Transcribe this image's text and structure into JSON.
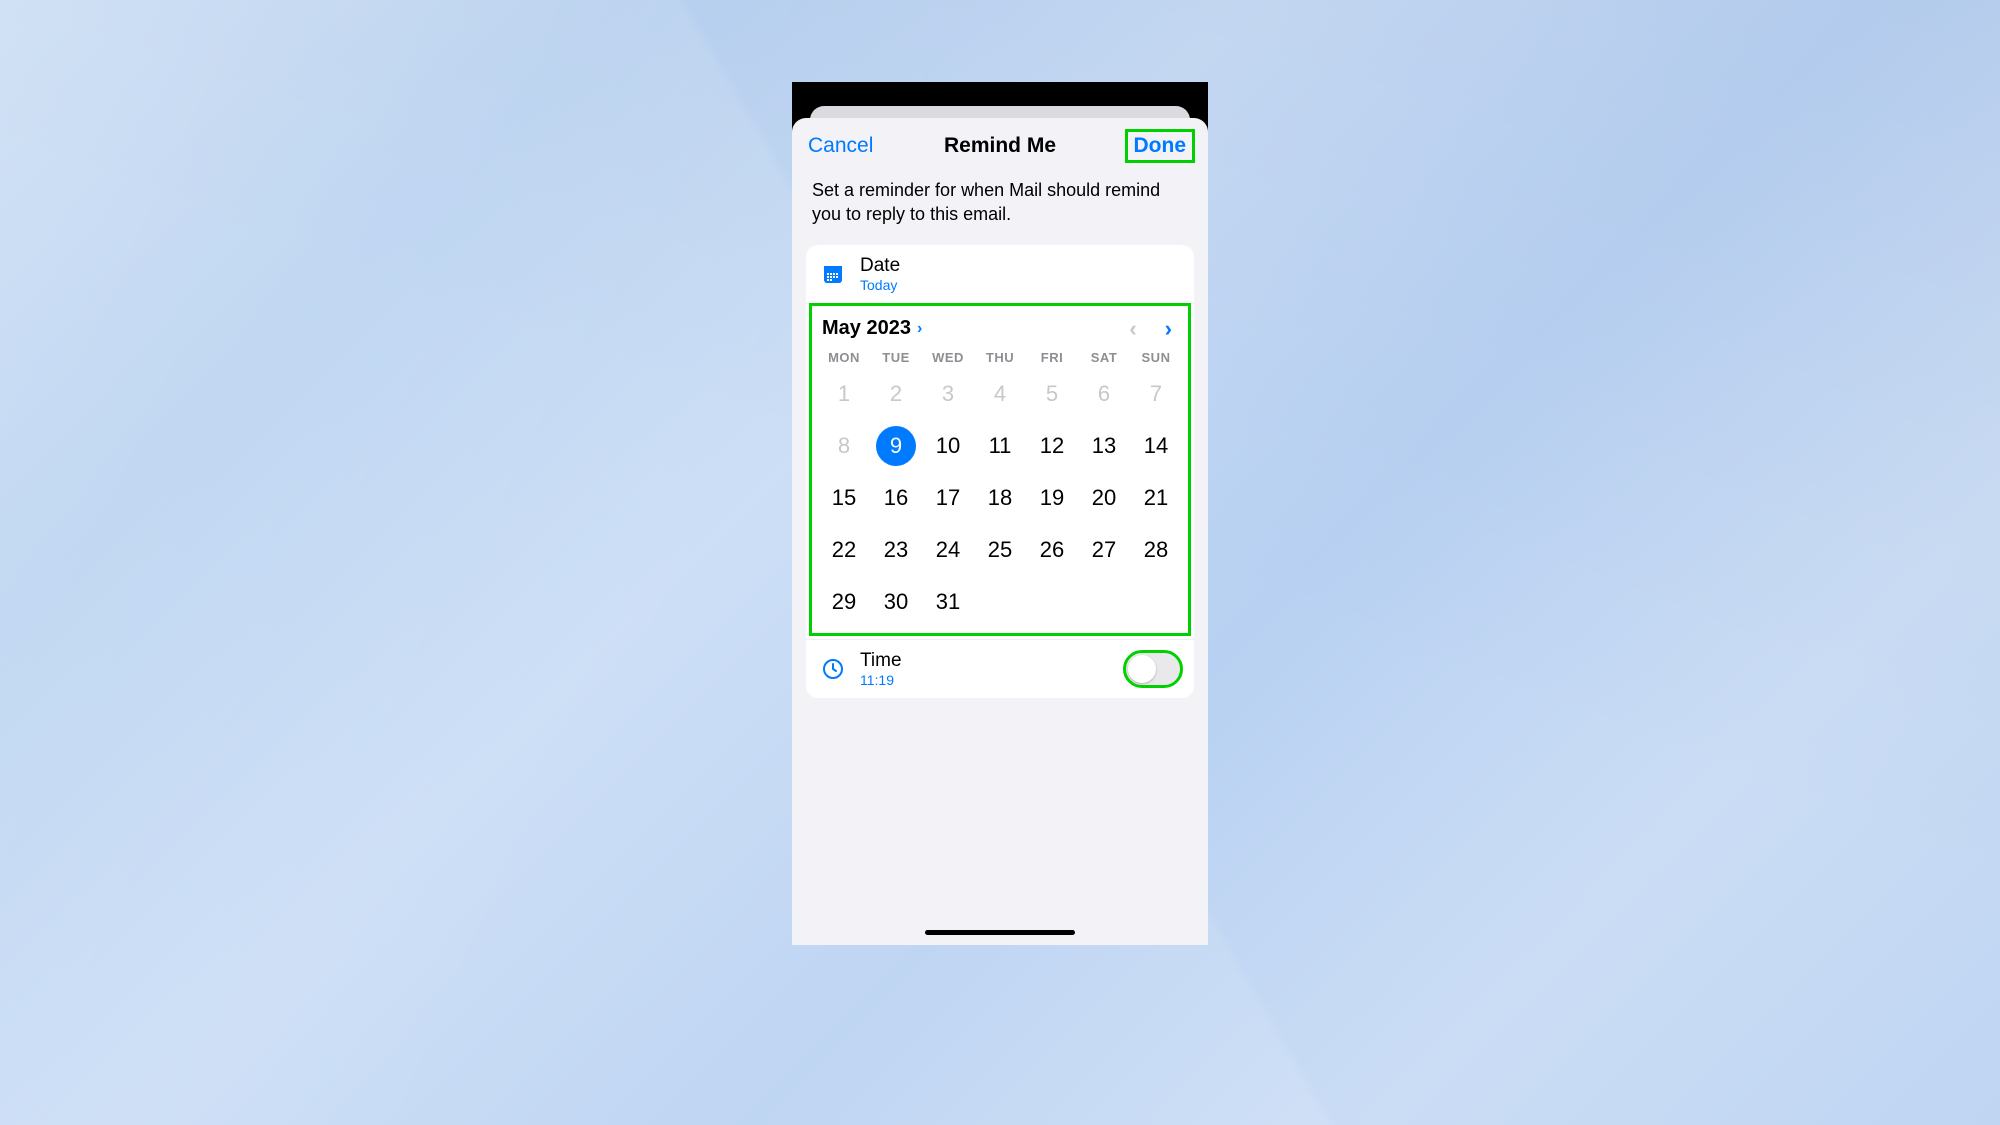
{
  "nav": {
    "cancel": "Cancel",
    "title": "Remind Me",
    "done": "Done"
  },
  "description": "Set a reminder for when Mail should remind you to reply to this email.",
  "date_section": {
    "label": "Date",
    "value": "Today"
  },
  "calendar": {
    "month_label": "May 2023",
    "prev_enabled": false,
    "next_enabled": true,
    "weekdays": [
      "MON",
      "TUE",
      "WED",
      "THU",
      "FRI",
      "SAT",
      "SUN"
    ],
    "selected_day": 9,
    "days": [
      {
        "n": "1",
        "dim": true
      },
      {
        "n": "2",
        "dim": true
      },
      {
        "n": "3",
        "dim": true
      },
      {
        "n": "4",
        "dim": true
      },
      {
        "n": "5",
        "dim": true
      },
      {
        "n": "6",
        "dim": true
      },
      {
        "n": "7",
        "dim": true
      },
      {
        "n": "8",
        "dim": true
      },
      {
        "n": "9",
        "sel": true
      },
      {
        "n": "10"
      },
      {
        "n": "11"
      },
      {
        "n": "12"
      },
      {
        "n": "13"
      },
      {
        "n": "14"
      },
      {
        "n": "15"
      },
      {
        "n": "16"
      },
      {
        "n": "17"
      },
      {
        "n": "18"
      },
      {
        "n": "19"
      },
      {
        "n": "20"
      },
      {
        "n": "21"
      },
      {
        "n": "22"
      },
      {
        "n": "23"
      },
      {
        "n": "24"
      },
      {
        "n": "25"
      },
      {
        "n": "26"
      },
      {
        "n": "27"
      },
      {
        "n": "28"
      },
      {
        "n": "29"
      },
      {
        "n": "30"
      },
      {
        "n": "31"
      }
    ]
  },
  "time_section": {
    "label": "Time",
    "value": "11:19",
    "enabled": false
  },
  "highlights": {
    "done": true,
    "calendar": true,
    "toggle": true
  },
  "colors": {
    "ios_blue": "#007aff",
    "highlight_green": "#00d000"
  }
}
